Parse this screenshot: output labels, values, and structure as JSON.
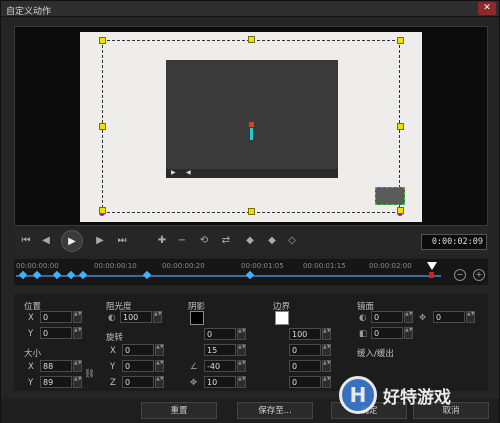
{
  "window": {
    "title": "自定义动作"
  },
  "controls": {
    "timecode": "0:00:02:09"
  },
  "timeline": {
    "ticks": [
      "00:00:00:00",
      "00:00:00:10",
      "00:00:00:20",
      "00:00:01:05",
      "00:00:01:15",
      "00:00:02:00"
    ]
  },
  "position": {
    "title": "位置",
    "x_label": "X",
    "x": "0",
    "y_label": "Y",
    "y": "0"
  },
  "size": {
    "title": "大小",
    "x_label": "X",
    "x": "88",
    "y_label": "Y",
    "y": "89"
  },
  "opacity": {
    "title": "阻光度",
    "value": "100"
  },
  "rotation": {
    "title": "旋转",
    "x_label": "X",
    "x": "0",
    "y_label": "Y",
    "y": "0",
    "z_label": "Z",
    "z": "0"
  },
  "shadow": {
    "title": "阴影",
    "v1": "0",
    "v2": "15",
    "v3": "-40",
    "v4": "10"
  },
  "border": {
    "title": "边界",
    "v1": "100",
    "v2": "0",
    "v3": "0",
    "v4": "0"
  },
  "mirror": {
    "title": "镜面",
    "v1": "0",
    "v2": "0",
    "v3": "0"
  },
  "fade": {
    "title": "缓入/缓出"
  },
  "buttons": {
    "reset": "重置",
    "save": "保存至...",
    "ok": "确定",
    "cancel": "取消"
  },
  "watermark": {
    "text": "好特游戏",
    "logo": "H"
  },
  "colors": {
    "accent": "#3a6aa0",
    "handle": "#f0e000",
    "keyframe": "#40b0ff"
  }
}
